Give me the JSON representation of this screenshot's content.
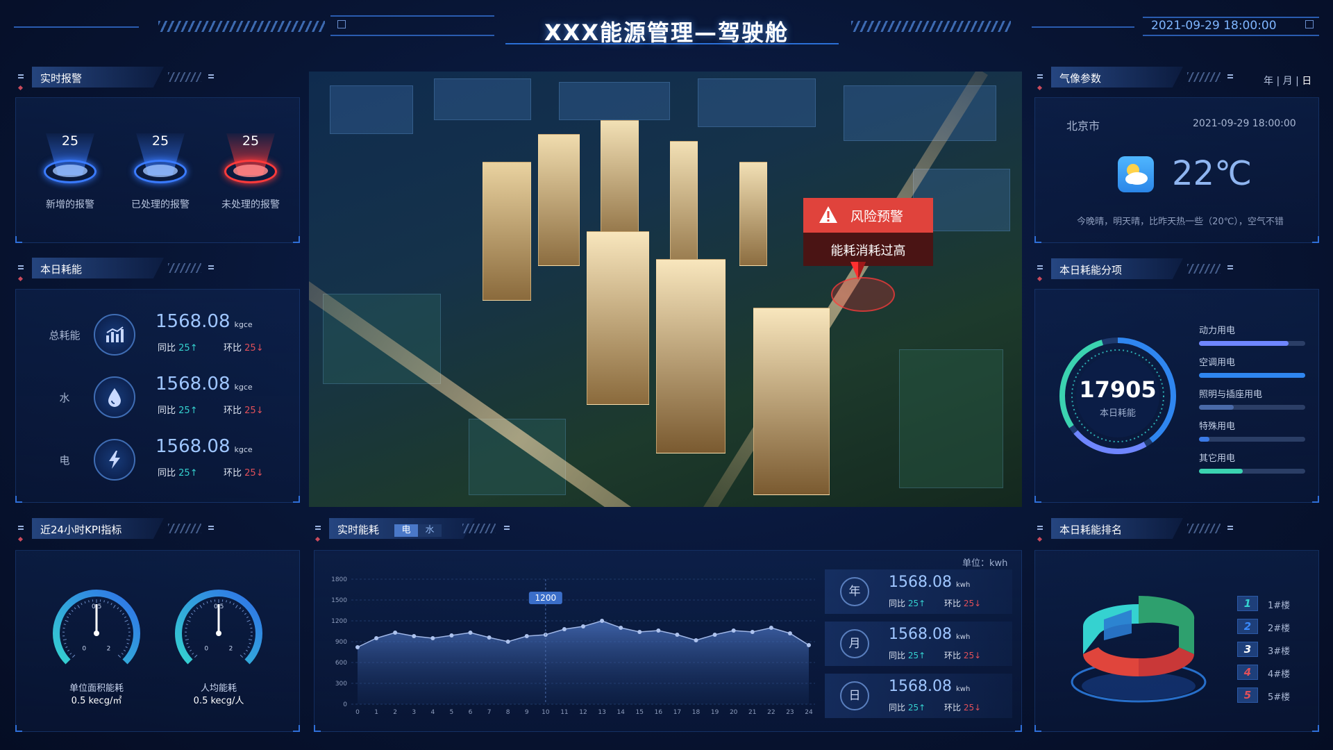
{
  "header": {
    "title": "XXX能源管理—驾驶舱",
    "datetime": "2021-09-29 18:00:00"
  },
  "alarms": {
    "title": "实时报警",
    "items": [
      {
        "count": "25",
        "label": "新增的报警",
        "color": "#3a7bff"
      },
      {
        "count": "25",
        "label": "已处理的报警",
        "color": "#3a7bff"
      },
      {
        "count": "25",
        "label": "未处理的报警",
        "color": "#ff3b3b"
      }
    ]
  },
  "daily_energy": {
    "title": "本日耗能",
    "rows": [
      {
        "name": "总耗能",
        "icon": "bar-chart-icon",
        "value": "1568.08",
        "unit": "kgce",
        "yoy_label": "同比",
        "yoy": "25↑",
        "mom_label": "环比",
        "mom": "25↓"
      },
      {
        "name": "水",
        "icon": "water-drop-icon",
        "value": "1568.08",
        "unit": "kgce",
        "yoy_label": "同比",
        "yoy": "25↑",
        "mom_label": "环比",
        "mom": "25↓"
      },
      {
        "name": "电",
        "icon": "lightning-icon",
        "value": "1568.08",
        "unit": "kgce",
        "yoy_label": "同比",
        "yoy": "25↑",
        "mom_label": "环比",
        "mom": "25↓"
      }
    ]
  },
  "scene": {
    "alert_title": "风险预警",
    "alert_message": "能耗消耗过高"
  },
  "weather": {
    "title": "气像参数",
    "range_year": "年",
    "range_month": "月",
    "range_day": "日",
    "city": "北京市",
    "time": "2021-09-29 18:00:00",
    "temperature": "22℃",
    "description": "今晚晴，明天晴，比昨天热一些（20℃），空气不错",
    "icon": "partly-cloudy-icon"
  },
  "breakdown": {
    "title": "本日耗能分项",
    "total": "17905",
    "total_label": "本日耗能",
    "items": [
      {
        "label": "动力用电",
        "fraction": 0.84,
        "color": "#6f86ff"
      },
      {
        "label": "空调用电",
        "fraction": 1.0,
        "color": "#2f86f0"
      },
      {
        "label": "照明与插座用电",
        "fraction": 0.33,
        "color": "#4a6aa8"
      },
      {
        "label": "特殊用电",
        "fraction": 0.1,
        "color": "#3b7ae6"
      },
      {
        "label": "其它用电",
        "fraction": 0.41,
        "color": "#3bd3b0"
      }
    ]
  },
  "kpi": {
    "title": "近24小时KPI指标",
    "gauges": [
      {
        "label": "单位面积能耗",
        "value_text": "0.5 kecg/㎡",
        "min": "0",
        "mid": "0.5",
        "max": "2",
        "value": 0.5
      },
      {
        "label": "人均能耗",
        "value_text": "0.5 kecg/人",
        "min": "0",
        "mid": "0.5",
        "max": "2",
        "value": 0.5
      }
    ]
  },
  "realtime": {
    "title": "实时能耗",
    "tab_active": "电",
    "tab_other": "水",
    "unit_label": "单位：kwh",
    "tooltip": "1200",
    "cards": [
      {
        "icon_label": "年",
        "value": "1568.08",
        "unit": "kwh",
        "yoy_label": "同比",
        "yoy": "25↑",
        "mom_label": "环比",
        "mom": "25↓"
      },
      {
        "icon_label": "月",
        "value": "1568.08",
        "unit": "kwh",
        "yoy_label": "同比",
        "yoy": "25↑",
        "mom_label": "环比",
        "mom": "25↓"
      },
      {
        "icon_label": "日",
        "value": "1568.08",
        "unit": "kwh",
        "yoy_label": "同比",
        "yoy": "25↑",
        "mom_label": "环比",
        "mom": "25↓"
      }
    ]
  },
  "chart_data": {
    "type": "area",
    "x": [
      0,
      1,
      2,
      3,
      4,
      5,
      6,
      7,
      8,
      9,
      10,
      11,
      12,
      13,
      14,
      15,
      16,
      17,
      18,
      19,
      20,
      21,
      22,
      23,
      24
    ],
    "values": [
      820,
      950,
      1030,
      980,
      950,
      990,
      1030,
      960,
      900,
      980,
      1000,
      1080,
      1120,
      1200,
      1100,
      1040,
      1060,
      1000,
      920,
      1000,
      1060,
      1040,
      1100,
      1020,
      850
    ],
    "yticks": [
      0,
      300,
      600,
      900,
      1200,
      1500,
      1800
    ],
    "ylim": [
      0,
      1800
    ],
    "xlabel": "",
    "ylabel": ""
  },
  "ranking": {
    "title": "本日耗能排名",
    "items": [
      {
        "rank": "1",
        "label": "1#楼",
        "color": "#35d2d0"
      },
      {
        "rank": "2",
        "label": "2#楼",
        "color": "#3a8bff"
      },
      {
        "rank": "3",
        "label": "3#楼",
        "color": "#ffffff"
      },
      {
        "rank": "4",
        "label": "4#楼",
        "color": "#e0505a"
      },
      {
        "rank": "5",
        "label": "5#楼",
        "color": "#e0505a"
      }
    ]
  }
}
